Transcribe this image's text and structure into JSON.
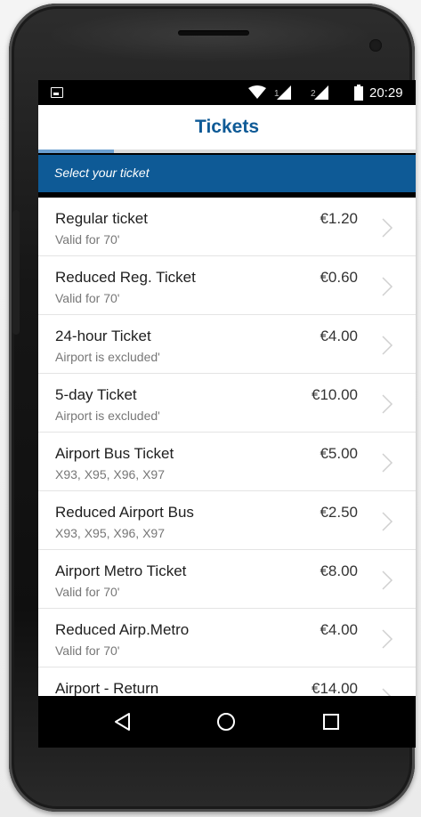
{
  "status_bar": {
    "time": "20:29",
    "sim1": "1",
    "sim2": "2"
  },
  "header": {
    "title": "Tickets",
    "progress": 0.2
  },
  "section": {
    "label": "Select your ticket"
  },
  "tickets": [
    {
      "name": "Regular ticket",
      "desc": "Valid for 70'",
      "price": "€1.20"
    },
    {
      "name": "Reduced Reg. Ticket",
      "desc": "Valid for 70'",
      "price": "€0.60"
    },
    {
      "name": "24-hour Ticket",
      "desc": "Airport is excluded'",
      "price": "€4.00"
    },
    {
      "name": "5-day Ticket",
      "desc": "Airport is excluded'",
      "price": "€10.00"
    },
    {
      "name": "Airport Bus Ticket",
      "desc": "X93, X95, X96, X97",
      "price": "€5.00"
    },
    {
      "name": "Reduced Airport Bus",
      "desc": "X93, X95, X96, X97",
      "price": "€2.50"
    },
    {
      "name": "Airport Metro Ticket",
      "desc": "Valid for 70'",
      "price": "€8.00"
    },
    {
      "name": "Reduced Airp.Metro",
      "desc": "Valid for 70'",
      "price": "€4.00"
    },
    {
      "name": "Airport - Return",
      "desc": "",
      "price": "€14.00"
    }
  ],
  "nav": {
    "back_icon": "back-triangle-icon",
    "home_icon": "home-circle-icon",
    "recent_icon": "recent-square-icon"
  },
  "colors": {
    "brand": "#0e5a96",
    "progress": "#6b9fd0"
  }
}
